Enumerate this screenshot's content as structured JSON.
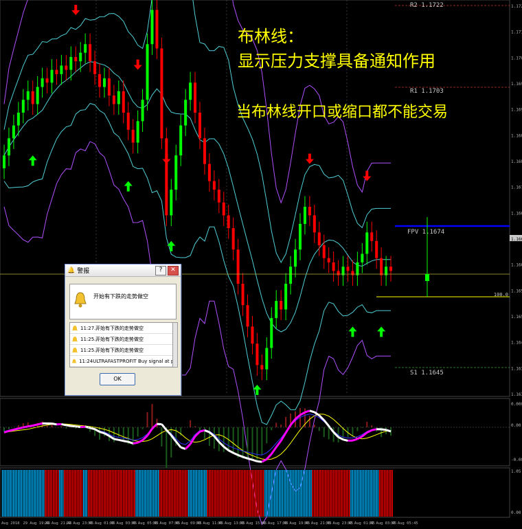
{
  "annotations": {
    "line1": "布林线：",
    "line2": "显示压力支撑具备通知作用",
    "line3": "当布林线开口或缩口都不能交易"
  },
  "pivots": {
    "r2": "R2 1.1722",
    "r1": "R1 1.1703",
    "fpv": "FPV 1.1674",
    "s1": "S1 1.1645"
  },
  "colors": {
    "background": "#000000",
    "bull_candle": "#00ff00",
    "bear_candle": "#ff0000",
    "band_inner": "#4fd0d8",
    "band_outer": "#b050ff",
    "fpv_line": "#0000ff",
    "alert_line": "#ffff00",
    "arrow_up": "#00ff00",
    "arrow_down": "#ff0000",
    "macd_main": "#ffffff",
    "macd_alt": "#ff00ff",
    "hist_up": "#00b4ff",
    "hist_down": "#ff0000"
  },
  "dialog": {
    "title": "警报",
    "question": "?",
    "close": "✕",
    "header_text": "开始有下跌的走势做空",
    "ok": "OK",
    "rows": [
      {
        "time": "11:27...",
        "text": "开始有下跌的走势做空"
      },
      {
        "time": "11:25...",
        "text": "开始有下跌的走势做空"
      },
      {
        "time": "11:25...",
        "text": "开始有下跌的走势做空"
      },
      {
        "time": "11:24",
        "text": "ULTRAFASTPROFIT Buy signal at price 0..."
      }
    ]
  },
  "chart_data": {
    "type": "candlestick",
    "y_axis_ticks": [
      "1.1722",
      "1.1710",
      "1.1703",
      "1.1698",
      "1.1692",
      "1.1686",
      "1.1680",
      "1.1674",
      "1.1668",
      "1.1664",
      "1.1662",
      "1.1656",
      "1.1650",
      "1.1645",
      "1.1639",
      "1.1635"
    ],
    "current_price": "1.1664",
    "alert_level_label": "100.0",
    "x_axis_ticks": [
      "Aug 2018",
      "29 Aug 19:45",
      "29 Aug 21:45",
      "29 Aug 23:45",
      "30 Aug 01:45",
      "30 Aug 03:45",
      "30 Aug 05:45",
      "30 Aug 07:45",
      "30 Aug 09:45",
      "30 Aug 11:45",
      "30 Aug 13:45",
      "30 Aug 15:45",
      "30 Aug 17:45",
      "30 Aug 19:45",
      "30 Aug 21:45",
      "30 Aug 23:45",
      "31 Aug 01:45",
      "31 Aug 03:45",
      "31 Aug 05:45"
    ],
    "close_series": [
      1.169,
      1.1694,
      1.1697,
      1.17,
      1.1703,
      1.1705,
      1.1702,
      1.1706,
      1.1708,
      1.1707,
      1.171,
      1.1709,
      1.1711,
      1.171,
      1.1713,
      1.1712,
      1.1714,
      1.1716,
      1.1712,
      1.1709,
      1.1706,
      1.1708,
      1.1704,
      1.1702,
      1.1705,
      1.17,
      1.1696,
      1.1693,
      1.1698,
      1.1703,
      1.1716,
      1.1724,
      1.1715,
      1.1694,
      1.1676,
      1.1682,
      1.169,
      1.1697,
      1.1703,
      1.1707,
      1.17,
      1.1694,
      1.1688,
      1.1684,
      1.1682,
      1.1679,
      1.1676,
      1.1673,
      1.1668,
      1.166,
      1.1655,
      1.165,
      1.1646,
      1.1641,
      1.164,
      1.1645,
      1.1652,
      1.1656,
      1.1654,
      1.166,
      1.1664,
      1.1668,
      1.1674,
      1.1678,
      1.1676,
      1.1672,
      1.1669,
      1.1666,
      1.1665,
      1.1663,
      1.1662,
      1.1664,
      1.1663,
      1.1662,
      1.1665,
      1.1667,
      1.1672,
      1.167,
      1.1666,
      1.1662,
      1.1664,
      1.1663
    ],
    "signals_up_index": [
      6,
      26,
      35,
      53,
      73,
      79
    ],
    "signals_down_index": [
      15,
      28,
      34,
      64,
      76
    ],
    "macd_range": [
      "0.00069",
      "0.00",
      "-0.0012"
    ],
    "hist_range": [
      "1.05",
      "0.00"
    ]
  }
}
